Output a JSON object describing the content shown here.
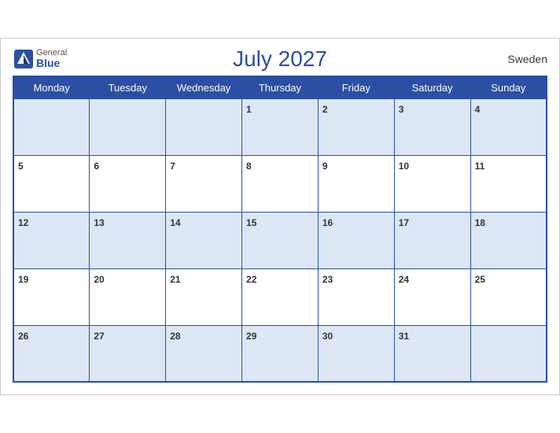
{
  "calendar": {
    "title": "July 2027",
    "country": "Sweden",
    "logo": {
      "general": "General",
      "blue": "Blue"
    },
    "days_of_week": [
      "Monday",
      "Tuesday",
      "Wednesday",
      "Thursday",
      "Friday",
      "Saturday",
      "Sunday"
    ],
    "weeks": [
      {
        "row_style": "odd",
        "days": [
          {
            "number": "",
            "empty": true
          },
          {
            "number": "",
            "empty": true
          },
          {
            "number": "",
            "empty": true
          },
          {
            "number": "1",
            "empty": false
          },
          {
            "number": "2",
            "empty": false
          },
          {
            "number": "3",
            "empty": false
          },
          {
            "number": "4",
            "empty": false
          }
        ]
      },
      {
        "row_style": "even",
        "days": [
          {
            "number": "5",
            "empty": false
          },
          {
            "number": "6",
            "empty": false
          },
          {
            "number": "7",
            "empty": false
          },
          {
            "number": "8",
            "empty": false
          },
          {
            "number": "9",
            "empty": false
          },
          {
            "number": "10",
            "empty": false
          },
          {
            "number": "11",
            "empty": false
          }
        ]
      },
      {
        "row_style": "odd",
        "days": [
          {
            "number": "12",
            "empty": false
          },
          {
            "number": "13",
            "empty": false
          },
          {
            "number": "14",
            "empty": false
          },
          {
            "number": "15",
            "empty": false
          },
          {
            "number": "16",
            "empty": false
          },
          {
            "number": "17",
            "empty": false
          },
          {
            "number": "18",
            "empty": false
          }
        ]
      },
      {
        "row_style": "even",
        "days": [
          {
            "number": "19",
            "empty": false
          },
          {
            "number": "20",
            "empty": false
          },
          {
            "number": "21",
            "empty": false
          },
          {
            "number": "22",
            "empty": false
          },
          {
            "number": "23",
            "empty": false
          },
          {
            "number": "24",
            "empty": false
          },
          {
            "number": "25",
            "empty": false
          }
        ]
      },
      {
        "row_style": "odd",
        "days": [
          {
            "number": "26",
            "empty": false
          },
          {
            "number": "27",
            "empty": false
          },
          {
            "number": "28",
            "empty": false
          },
          {
            "number": "29",
            "empty": false
          },
          {
            "number": "30",
            "empty": false
          },
          {
            "number": "31",
            "empty": false
          },
          {
            "number": "",
            "empty": true
          }
        ]
      }
    ]
  }
}
